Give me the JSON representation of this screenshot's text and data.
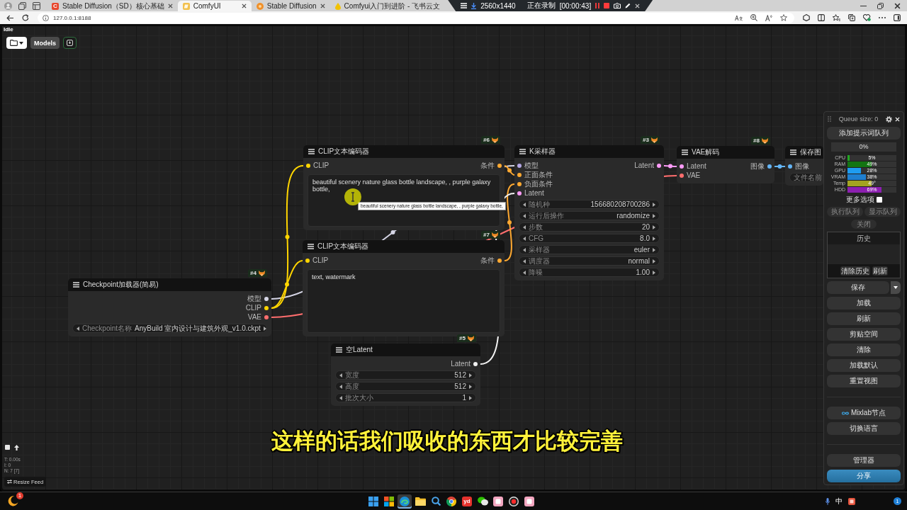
{
  "browser": {
    "tabs": [
      {
        "kind": "letter-tile",
        "favicon_text": "C",
        "title": "Stable Diffusion（SD）核心基础",
        "selected": false,
        "close_button": true
      },
      {
        "kind": "comfy",
        "title": "ComfyUI",
        "selected": true,
        "close_button": true
      },
      {
        "kind": "sd",
        "title": "Stable Diffusion",
        "selected": false,
        "close_button": true
      },
      {
        "kind": "drop",
        "title": "Comfyui入门到进阶 - 飞书云文",
        "selected": false,
        "close_button": false
      }
    ],
    "recording_bar": {
      "resolution": "2560x1440",
      "status": "正在录制",
      "timer": "[00:00:43]"
    },
    "address": "127.0.0.1:8188"
  },
  "comfy_app": {
    "status": "Idle",
    "toolbar": {
      "models_button": "Models"
    },
    "nodes": [
      {
        "badge": "#4",
        "title": "Checkpoint加载器(简易)",
        "outputs": [
          {
            "label": "模型",
            "color": "#d6d6e6"
          },
          {
            "label": "CLIP",
            "color": "#ffd500"
          },
          {
            "label": "VAE",
            "color": "#ff6e6e"
          }
        ],
        "widgets": [
          {
            "kind": "combo",
            "label": "Checkpoint名称",
            "value": "AnyBuild 室内设计与建筑外观_v1.0.ckpt"
          }
        ]
      },
      {
        "badge": "#6",
        "title": "CLIP文本编码器",
        "inputs": [
          {
            "label": "CLIP",
            "color": "#ffd500"
          }
        ],
        "outputs": [
          {
            "label": "条件",
            "color": "#ffa931"
          }
        ],
        "widgets": [
          {
            "kind": "text",
            "value": "beautiful scenery nature glass bottle landscape, , purple galaxy bottle,"
          }
        ]
      },
      {
        "badge": "#7",
        "title": "CLIP文本编码器",
        "inputs": [
          {
            "label": "CLIP",
            "color": "#ffd500"
          }
        ],
        "outputs": [
          {
            "label": "条件",
            "color": "#ffa931"
          }
        ],
        "widgets": [
          {
            "kind": "text",
            "value": "text, watermark"
          }
        ]
      },
      {
        "badge": "#5",
        "title": "空Latent",
        "outputs": [
          {
            "label": "Latent",
            "color": "#f2f2f2"
          }
        ],
        "widgets": [
          {
            "kind": "number",
            "label": "宽度",
            "value": "512"
          },
          {
            "kind": "number",
            "label": "高度",
            "value": "512"
          },
          {
            "kind": "number",
            "label": "批次大小",
            "value": "1"
          }
        ]
      },
      {
        "badge": "#3",
        "title": "K采样器",
        "inputs": [
          {
            "label": "模型",
            "color": "#b4a7e5"
          },
          {
            "label": "正面条件",
            "color": "#ffa931"
          },
          {
            "label": "负面条件",
            "color": "#ffa931"
          },
          {
            "label": "Latent",
            "color": "#ff9cf9"
          }
        ],
        "outputs": [
          {
            "label": "Latent",
            "color": "#ff9cf9"
          }
        ],
        "widgets": [
          {
            "kind": "number",
            "label": "随机种",
            "value": "156680208700286"
          },
          {
            "kind": "combo",
            "label": "运行后操作",
            "value": "randomize"
          },
          {
            "kind": "number",
            "label": "步数",
            "value": "20"
          },
          {
            "kind": "number",
            "label": "CFG",
            "value": "8.0"
          },
          {
            "kind": "combo",
            "label": "采样器",
            "value": "euler"
          },
          {
            "kind": "combo",
            "label": "调度器",
            "value": "normal"
          },
          {
            "kind": "number",
            "label": "降噪",
            "value": "1.00"
          }
        ]
      },
      {
        "badge": "#8",
        "title": "VAE解码",
        "inputs": [
          {
            "label": "Latent",
            "color": "#ff9cf9"
          },
          {
            "label": "VAE",
            "color": "#ff6e6e"
          }
        ],
        "outputs": [
          {
            "label": "图像",
            "color": "#64b5f6"
          }
        ]
      },
      {
        "title": "保存图",
        "inputs": [
          {
            "label": "图像",
            "color": "#64b5f6"
          }
        ],
        "widgets": [
          {
            "kind": "string",
            "label": "文件名前"
          }
        ]
      }
    ],
    "tooltip": "beautiful scenery nature glass bottle landscape, , purple galaxy bottle,",
    "side_panel": {
      "title": "Queue size: 0",
      "queue_button": "添加提示词队列",
      "progress": {
        "label": "0%",
        "level": 0
      },
      "monitors": [
        {
          "label": "CPU",
          "reading": "5%",
          "level": 0.05,
          "color": "#22a822"
        },
        {
          "label": "RAM",
          "reading": "49%",
          "level": 0.49,
          "color": "#137513"
        },
        {
          "label": "GPU",
          "reading": "28%",
          "level": 0.28,
          "color": "#1e9cf0"
        },
        {
          "label": "VRAM",
          "reading": "38%",
          "level": 0.38,
          "color": "#1f7fcf"
        },
        {
          "label": "Temp",
          "reading": "49°",
          "level": 0.49,
          "color": "#a3a320"
        },
        {
          "label": "HDD",
          "reading": "69%",
          "level": 0.69,
          "color": "#8c1fb0"
        }
      ],
      "more_options": {
        "label": "更多选项",
        "checked": false
      },
      "queue_buttons": [
        "执行队列",
        "显示队列"
      ],
      "close_button": "关闭",
      "history": {
        "title": "历史",
        "buttons": [
          "清除历史",
          "刷新"
        ]
      },
      "save_button": "保存",
      "buttons": [
        "加载",
        "刷新",
        "剪贴空间",
        "清除",
        "加载默认",
        "重置视图"
      ],
      "extra_buttons": [
        {
          "kind": "mixlab",
          "label": "Mixlab节点"
        },
        {
          "kind": "plain",
          "label": "切换语言"
        }
      ],
      "bottom_buttons": [
        {
          "kind": "plain",
          "label": "管理器"
        },
        {
          "kind": "primary",
          "label": "分享"
        }
      ]
    },
    "stats": [
      "T: 0.00s",
      "I: 0",
      "N: 7 [7]"
    ],
    "resize_button": "Resize Feed",
    "subtitle": "这样的话我们吸收的东西才比较完善"
  },
  "taskbar": {
    "weather_badge": "1",
    "apps": [
      {
        "kind": "start",
        "selected": false
      },
      {
        "kind": "store",
        "selected": false
      },
      {
        "kind": "browser",
        "selected": true
      },
      {
        "kind": "folder",
        "selected": false
      },
      {
        "kind": "search",
        "selected": false
      },
      {
        "kind": "ring",
        "selected": false
      },
      {
        "kind": "letter-tile",
        "label": "yd",
        "selected": false
      },
      {
        "kind": "chat",
        "selected": false
      },
      {
        "kind": "pink-tile",
        "selected": false
      },
      {
        "kind": "record",
        "selected": false
      },
      {
        "kind": "pink-tile",
        "selected": false
      }
    ],
    "ime": "中",
    "notification_badge": "1"
  }
}
